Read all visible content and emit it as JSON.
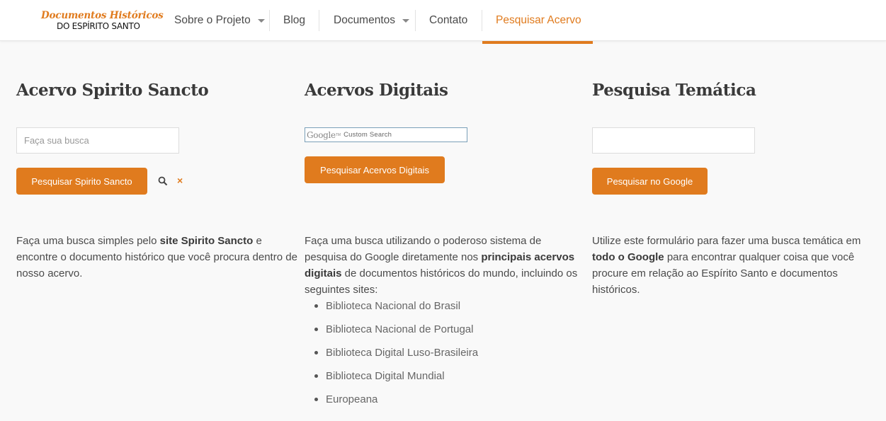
{
  "logo": {
    "line1": "Documentos Históricos",
    "line2": "DO ESPÍRITO SANTO"
  },
  "nav": {
    "items": [
      {
        "label": "Sobre o Projeto",
        "has_dropdown": true
      },
      {
        "label": "Blog",
        "has_dropdown": false
      },
      {
        "label": "Documentos",
        "has_dropdown": true
      },
      {
        "label": "Contato",
        "has_dropdown": false
      },
      {
        "label": "Pesquisar Acervo",
        "has_dropdown": false,
        "active": true
      }
    ]
  },
  "colors": {
    "accent": "#e07b1e",
    "text": "#4a4a4a",
    "background": "#f9f9f9"
  },
  "columns": {
    "spirito": {
      "title": "Acervo Spirito Sancto",
      "search_placeholder": "Faça sua busca",
      "button": "Pesquisar Spirito Sancto",
      "search_icon": "search-icon",
      "clear_icon": "close-icon",
      "clear_glyph": "×",
      "desc_pre": "Faça uma busca simples pelo ",
      "desc_bold": "site Spirito Sancto",
      "desc_post": " e encontre o documento histórico que você procura dentro de nosso acervo."
    },
    "digitais": {
      "title": "Acervos Digitais",
      "google_word": "Google",
      "google_tm": "TM",
      "google_suffix": "Custom Search",
      "button": "Pesquisar Acervos Digitais",
      "desc_pre": "Faça uma busca utilizando o poderoso sistema de pesquisa do Google diretamente nos ",
      "desc_bold": "principais acervos digitais",
      "desc_post": " de documentos históricos do mundo, incluindo os seguintes sites:",
      "sites": [
        "Biblioteca Nacional do Brasil",
        "Biblioteca Nacional de Portugal",
        "Biblioteca Digital Luso-Brasileira",
        "Biblioteca Digital Mundial",
        "Europeana"
      ]
    },
    "tematica": {
      "title": "Pesquisa Temática",
      "search_value": "",
      "button": "Pesquisar no Google",
      "desc_pre": "Utilize este formulário para fazer uma busca temática em ",
      "desc_bold": "todo o Google",
      "desc_post": " para encontrar qualquer coisa que você procure em relação ao Espírito Santo e documentos históricos."
    }
  }
}
